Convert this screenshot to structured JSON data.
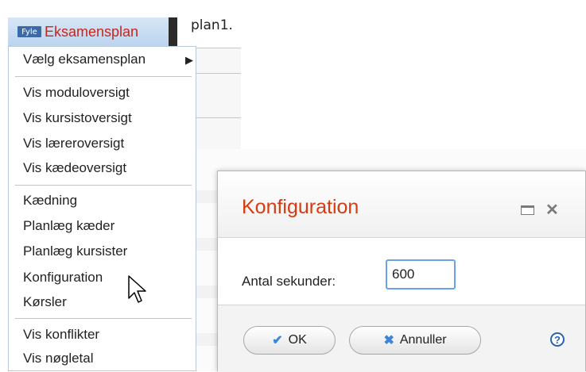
{
  "menu": {
    "button_label": "Eksamensplan",
    "icon_text": "Fyle",
    "items": [
      "Vælg eksamensplan",
      "Vis moduloversigt",
      "Vis kursistoversigt",
      "Vis læreroversigt",
      "Vis kædeoversigt",
      "Kædning",
      "Planlæg kæder",
      "Planlæg kursister",
      "Konfiguration",
      "Kørsler",
      "Vis konflikter",
      "Vis nøgletal"
    ],
    "submenu_arrow": "▶"
  },
  "background": {
    "tab_text": "plan1."
  },
  "dialog": {
    "title": "Konfiguration",
    "field_label": "Antal sekunder:",
    "field_value": "600",
    "ok_label": "OK",
    "cancel_label": "Annuller",
    "help_label": "?"
  },
  "colors": {
    "menu_label": "#c8251b",
    "dialog_title": "#d63b12",
    "accent_blue": "#3c86d8"
  },
  "icons": [
    "app-icon",
    "submenu-arrow-icon",
    "cursor-icon",
    "maximize-icon",
    "close-icon",
    "check-icon",
    "cancel-x-icon",
    "help-icon"
  ]
}
